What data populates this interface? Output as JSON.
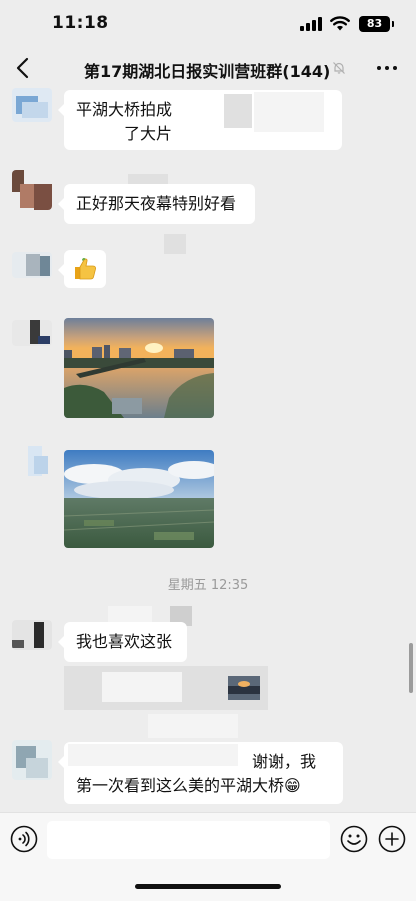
{
  "status_bar": {
    "time": "11:18",
    "battery": "83"
  },
  "nav": {
    "title": "第17期湖北日报实训营班群(144)"
  },
  "messages": [
    {
      "type": "text",
      "lines": [
        "平湖大桥拍成",
        "了大片"
      ]
    },
    {
      "type": "text",
      "text": "正好那天夜幕特别好看"
    },
    {
      "type": "emoji",
      "icon": "thumbs-up-icon"
    },
    {
      "type": "image",
      "subject": "sunset-lake-photo"
    },
    {
      "type": "image",
      "subject": "aerial-landscape-photo"
    },
    {
      "type": "text",
      "text": "我也喜欢这张"
    },
    {
      "type": "quote"
    },
    {
      "type": "text",
      "lines": [
        "谢谢，我",
        "第一次看到这么美的平湖大桥😁"
      ]
    }
  ],
  "timestamp": "星期五 12:35",
  "input": {
    "placeholder": ""
  },
  "colors": {
    "background": "#ededed",
    "bubble": "#ffffff",
    "input_bar": "#f7f7f7"
  }
}
